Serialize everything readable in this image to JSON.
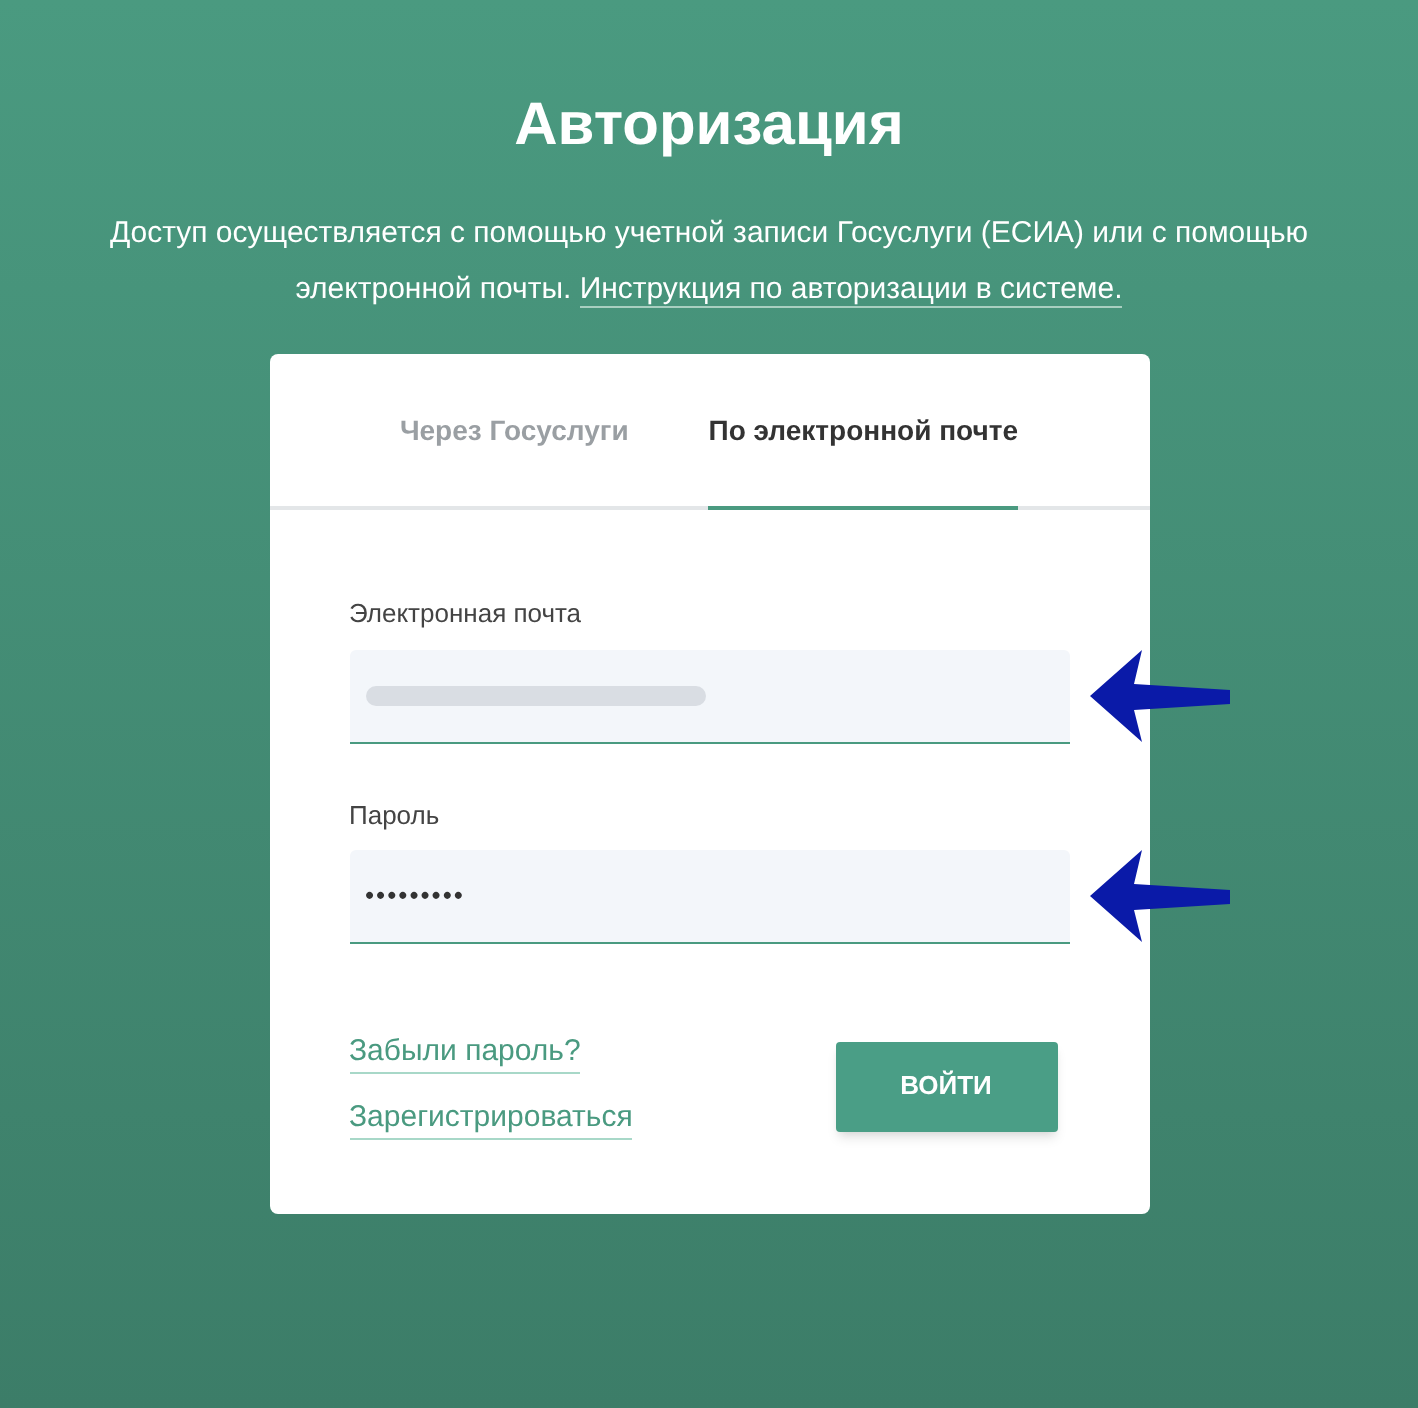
{
  "title": "Авторизация",
  "intro": {
    "text": "Доступ осуществляется с помощью учетной записи Госуслуги (ЕСИА) или с помощью электронной почты.",
    "link": "Инструкция по авторизации в системе."
  },
  "tabs": [
    {
      "label": "Через Госуслуги",
      "selected": false
    },
    {
      "label": "По электронной почте",
      "selected": true
    }
  ],
  "fields": [
    {
      "label": "Электронная почта",
      "kind": "blurred"
    },
    {
      "label": "Пароль",
      "kind": "password",
      "value": "•••••••••"
    }
  ],
  "links": [
    "Забыли пароль?",
    "Зарегистрироваться"
  ],
  "submit": "ВОЙТИ"
}
